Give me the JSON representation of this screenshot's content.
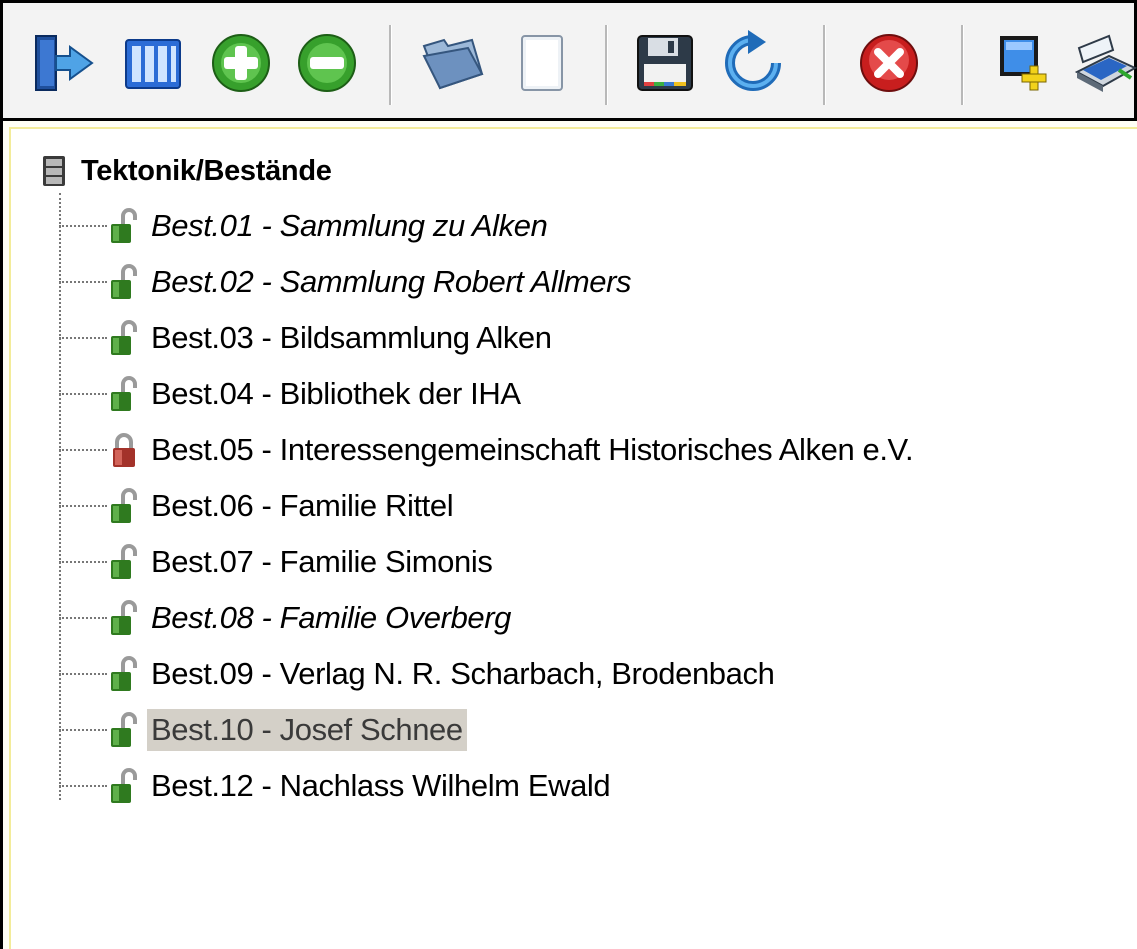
{
  "toolbar": {
    "buttons": [
      {
        "name": "exit-button",
        "icon": "exit-door-icon"
      },
      {
        "name": "columns-button",
        "icon": "columns-icon"
      },
      {
        "name": "add-button",
        "icon": "plus-circle-icon"
      },
      {
        "name": "remove-button",
        "icon": "minus-circle-icon"
      },
      {
        "name": "open-folder-button",
        "icon": "folder-icon"
      },
      {
        "name": "new-document-button",
        "icon": "blank-document-icon"
      },
      {
        "name": "save-button",
        "icon": "floppy-disk-icon"
      },
      {
        "name": "refresh-button",
        "icon": "refresh-icon"
      },
      {
        "name": "delete-button",
        "icon": "red-x-circle-icon"
      },
      {
        "name": "new-window-button",
        "icon": "window-plus-icon"
      },
      {
        "name": "scan-button",
        "icon": "scanner-icon"
      }
    ]
  },
  "tree": {
    "root_label": "Tektonik/Bestände",
    "items": [
      {
        "label": "Best.01 - Sammlung zu Alken",
        "italic": true,
        "lock": "green",
        "selected": false
      },
      {
        "label": "Best.02 - Sammlung Robert Allmers",
        "italic": true,
        "lock": "green",
        "selected": false
      },
      {
        "label": "Best.03 - Bildsammlung Alken",
        "italic": false,
        "lock": "green",
        "selected": false
      },
      {
        "label": "Best.04 - Bibliothek der IHA",
        "italic": false,
        "lock": "green",
        "selected": false
      },
      {
        "label": "Best.05 - Interessengemeinschaft Historisches Alken e.V.",
        "italic": false,
        "lock": "red",
        "selected": false
      },
      {
        "label": "Best.06 - Familie Rittel",
        "italic": false,
        "lock": "green",
        "selected": false
      },
      {
        "label": "Best.07 - Familie Simonis",
        "italic": false,
        "lock": "green",
        "selected": false
      },
      {
        "label": "Best.08 - Familie Overberg",
        "italic": true,
        "lock": "green",
        "selected": false
      },
      {
        "label": "Best.09 - Verlag N. R. Scharbach, Brodenbach",
        "italic": false,
        "lock": "green",
        "selected": false
      },
      {
        "label": "Best.10 - Josef Schnee",
        "italic": false,
        "lock": "green",
        "selected": true
      },
      {
        "label": "Best.12 - Nachlass Wilhelm Ewald",
        "italic": false,
        "lock": "green",
        "selected": false
      }
    ]
  }
}
